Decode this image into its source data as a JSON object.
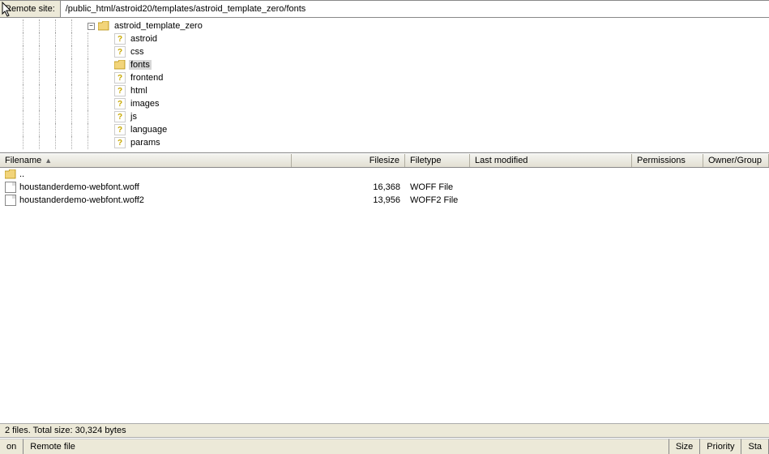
{
  "pathbar": {
    "label": "Remote site:",
    "value": "/public_html/astroid20/templates/astroid_template_zero/fonts"
  },
  "tree": {
    "root": "astroid_template_zero",
    "items": [
      {
        "name": "astroid",
        "kind": "unknown"
      },
      {
        "name": "css",
        "kind": "unknown"
      },
      {
        "name": "fonts",
        "kind": "folder",
        "selected": true
      },
      {
        "name": "frontend",
        "kind": "unknown"
      },
      {
        "name": "html",
        "kind": "unknown"
      },
      {
        "name": "images",
        "kind": "unknown"
      },
      {
        "name": "js",
        "kind": "unknown"
      },
      {
        "name": "language",
        "kind": "unknown"
      },
      {
        "name": "params",
        "kind": "unknown"
      }
    ]
  },
  "columns": {
    "filename": "Filename",
    "filesize": "Filesize",
    "filetype": "Filetype",
    "modified": "Last modified",
    "permissions": "Permissions",
    "owner": "Owner/Group"
  },
  "files": {
    "parent": "..",
    "rows": [
      {
        "name": "houstanderdemo-webfont.woff",
        "size": "16,368",
        "type": "WOFF File"
      },
      {
        "name": "houstanderdemo-webfont.woff2",
        "size": "13,956",
        "type": "WOFF2 File"
      }
    ]
  },
  "status": "2 files. Total size: 30,324 bytes",
  "bottom": {
    "seg1": "on",
    "seg2": "Remote file",
    "seg3": "Size",
    "seg4": "Priority",
    "seg5": "Sta"
  }
}
